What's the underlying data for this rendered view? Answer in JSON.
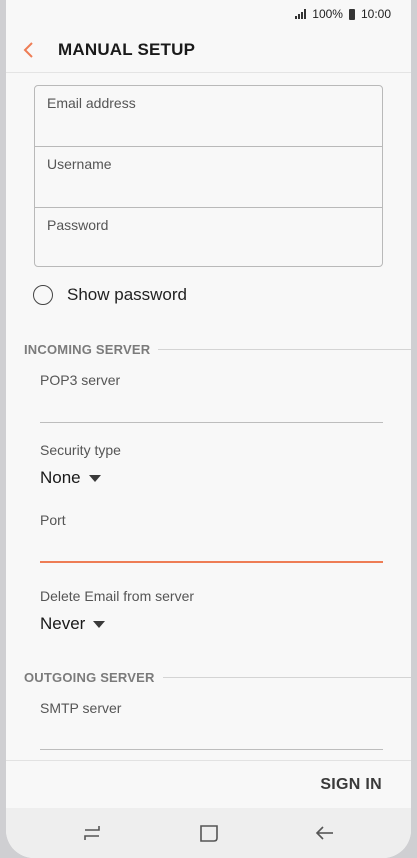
{
  "status_bar": {
    "battery_text": "100%",
    "time": "10:00"
  },
  "header": {
    "title": "MANUAL SETUP"
  },
  "account_fields": [
    {
      "label": "Email address"
    },
    {
      "label": "Username"
    },
    {
      "label": "Password"
    }
  ],
  "show_password": {
    "label": "Show password"
  },
  "incoming": {
    "heading": "INCOMING SERVER",
    "pop3_label": "POP3 server",
    "security_label": "Security type",
    "security_value": "None",
    "port_label": "Port",
    "delete_label": "Delete Email from server",
    "delete_value": "Never"
  },
  "outgoing": {
    "heading": "OUTGOING SERVER",
    "smtp_label": "SMTP server"
  },
  "actions": {
    "sign_in": "SIGN IN"
  },
  "colors": {
    "accent": "#ee7d55",
    "background": "#f8f8f8"
  },
  "icons": [
    "back-arrow-icon",
    "signal-icon",
    "battery-icon",
    "recents-icon",
    "home-icon",
    "back-icon"
  ]
}
